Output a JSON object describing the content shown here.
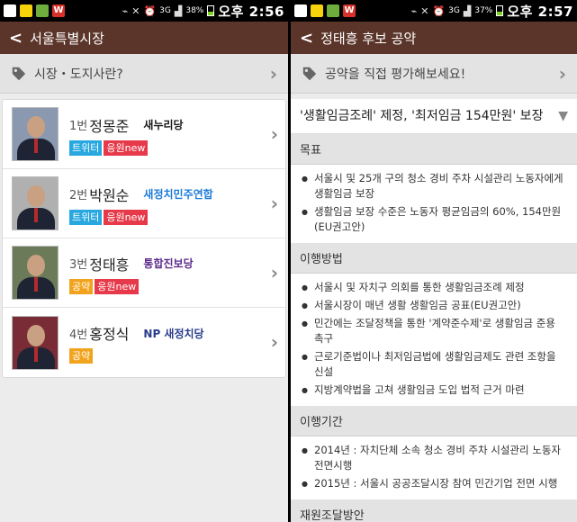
{
  "left": {
    "status": {
      "time": "오후 2:56",
      "battery": "38%",
      "battery_level": 0.38,
      "signal": "3G"
    },
    "appbar": {
      "back": "<",
      "title": "서울특별시장"
    },
    "section": {
      "label": "시장・도지사란?"
    },
    "candidates": [
      {
        "num": "1번",
        "name": "정몽준",
        "party": "새누리당",
        "party_color": "#1a1a1a",
        "photo_bg": "#8a99b0",
        "badges": [
          {
            "label": "트위터",
            "kind": "blue"
          },
          {
            "label": "응원new",
            "kind": "red"
          }
        ]
      },
      {
        "num": "2번",
        "name": "박원순",
        "party": "새정치민주연합",
        "party_color": "#1d7bd8",
        "photo_bg": "#b0b0b0",
        "badges": [
          {
            "label": "트위터",
            "kind": "blue"
          },
          {
            "label": "응원new",
            "kind": "red"
          }
        ]
      },
      {
        "num": "3번",
        "name": "정태흥",
        "party": "통합진보당",
        "party_color": "#5d2a8c",
        "photo_bg": "#6b7a58",
        "badges": [
          {
            "label": "공약",
            "kind": "orange"
          },
          {
            "label": "응원new",
            "kind": "red"
          }
        ]
      },
      {
        "num": "4번",
        "name": "홍정식",
        "party": "NP 새정치당",
        "party_color": "#2a3c8c",
        "photo_bg": "#7a2c36",
        "badges": [
          {
            "label": "공약",
            "kind": "orange"
          }
        ]
      }
    ]
  },
  "right": {
    "status": {
      "time": "오후 2:57",
      "battery": "37%",
      "battery_level": 0.37,
      "signal": "3G"
    },
    "appbar": {
      "back": "<",
      "title": "정태흥 후보 공약"
    },
    "section": {
      "label": "공약을 직접 평가해보세요!"
    },
    "pledge_title": "'생활임금조례' 제정, '최저임금 154만원' 보장",
    "blocks": [
      {
        "heading": "목표",
        "items": [
          "서울시 및 25개 구의 청소 경비 주차 시설관리 노동자에게 생활임금 보장",
          "생활임금 보장 수준은 노동자 평균임금의 60%, 154만원(EU권고안)"
        ]
      },
      {
        "heading": "이행방법",
        "items": [
          "서울시 및 자치구 의회를 통한 생활임금조례 제정",
          "서울시장이 매년 생활 생활임금 공표(EU권고안)",
          "민간에는 조달정책을 통한 '계약준수제'로 생활임금 준용 촉구",
          "근로기준법이나 최저임금법에 생활임금제도 관련 조항을 신설",
          "지방계약법을 고쳐 생활임금 도입 법적 근거 마련"
        ]
      },
      {
        "heading": "이행기간",
        "items": [
          "2014년 : 자치단체 소속 청소 경비 주차 시설관리 노동자 전면시행",
          "2015년 : 서울시 공공조달시장 참여 민간기업 전면 시행"
        ]
      },
      {
        "heading": "재원조달방안",
        "items": []
      }
    ]
  },
  "colors": {
    "appbar": "#5b3529",
    "twitter_badge": "#29a8e0",
    "cheer_badge": "#e63a4a",
    "pledge_badge": "#f2a31d"
  }
}
